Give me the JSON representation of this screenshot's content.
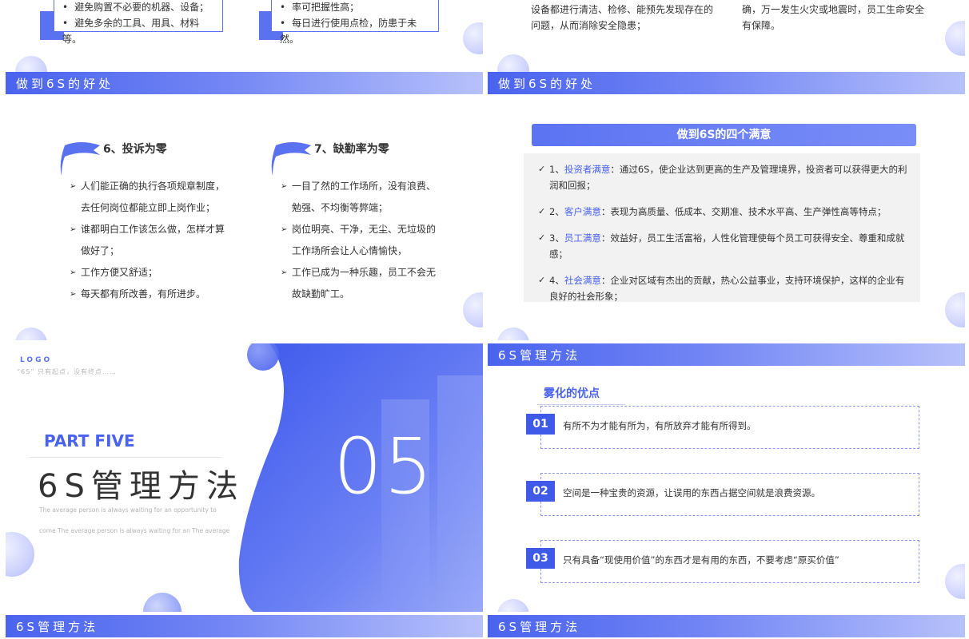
{
  "slideA": {
    "card1_items": [
      "避免购置不必要的机器、设备；",
      "避免多余的工具、用具、材料等。"
    ],
    "card2_items": [
      "率可把握性高；",
      "每日进行使用点检，防患于未然。"
    ]
  },
  "slideB": {
    "col1_text": "设备都进行清洁、检修、能预先发现存在的问题，从而消除安全隐患；",
    "col2_text": "确，万一发生火灾或地震时，员工生命安全有保障。"
  },
  "slideC": {
    "bar_title": "做到6S的好处",
    "col1": {
      "heading": "6、投诉为零",
      "items": [
        "人们能正确的执行各项规章制度，去任何岗位都能立即上岗作业；",
        "谁都明白工作该怎么做，怎样才算做好了；",
        "工作方便又舒适；",
        "每天都有所改善，有所进步。"
      ]
    },
    "col2": {
      "heading": "7、缺勤率为零",
      "items": [
        "一目了然的工作场所，没有浪费、勉强、不均衡等弊端；",
        "岗位明亮、干净，无尘、无垃圾的工作场所会让人心情愉快，",
        "工作已成为一种乐趣，员工不会无故缺勤旷工。"
      ]
    }
  },
  "slideD": {
    "bar_title": "做到6S的好处",
    "banner": "做到6S的四个满意",
    "items": [
      {
        "num": "1、",
        "key": "投资者满意",
        "text": "：通过6S，使企业达到更高的生产及管理境界，投资者可以获得更大的利润和回报；"
      },
      {
        "num": "2、",
        "key": "客户满意",
        "text": "：表现为高质量、低成本、交期准、技术水平高、生产弹性高等特点；"
      },
      {
        "num": "3、",
        "key": "员工满意",
        "text": "：效益好，员工生活富裕，人性化管理使每个员工可获得安全、尊重和成就感；"
      },
      {
        "num": "4、",
        "key": "社会满意",
        "text": "：企业对区域有杰出的贡献，热心公益事业，支持环境保护，这样的企业有良好的社会形象；"
      }
    ]
  },
  "slideE": {
    "logo": "LOGO",
    "tagline": "“6S” 只有起点，没有终点……",
    "part": "PART FIVE",
    "title": "6S管理方法",
    "desc": "The average person is always waiting for an opportunity to come The average person is always waiting for an The average",
    "number": "05"
  },
  "slideF": {
    "bar_title": "6S管理方法",
    "heading": "雾化的优点",
    "rows": [
      {
        "num": "01",
        "text": "有所不为才能有所为，有所放弃才能有所得到。"
      },
      {
        "num": "02",
        "text": "空间是一种宝贵的资源，让误用的东西占据空间就是浪费资源。"
      },
      {
        "num": "03",
        "text": "只有具备“现使用价值”的东西才是有用的东西，不要考虑“原买价值”"
      }
    ]
  },
  "slideG": {
    "bar_title": "6S管理方法"
  },
  "slideH": {
    "bar_title": "6S管理方法"
  },
  "colors": {
    "accent": "#4a63ee",
    "accent_light": "#b7c1fb",
    "gray_box": "#f2f2f2"
  }
}
